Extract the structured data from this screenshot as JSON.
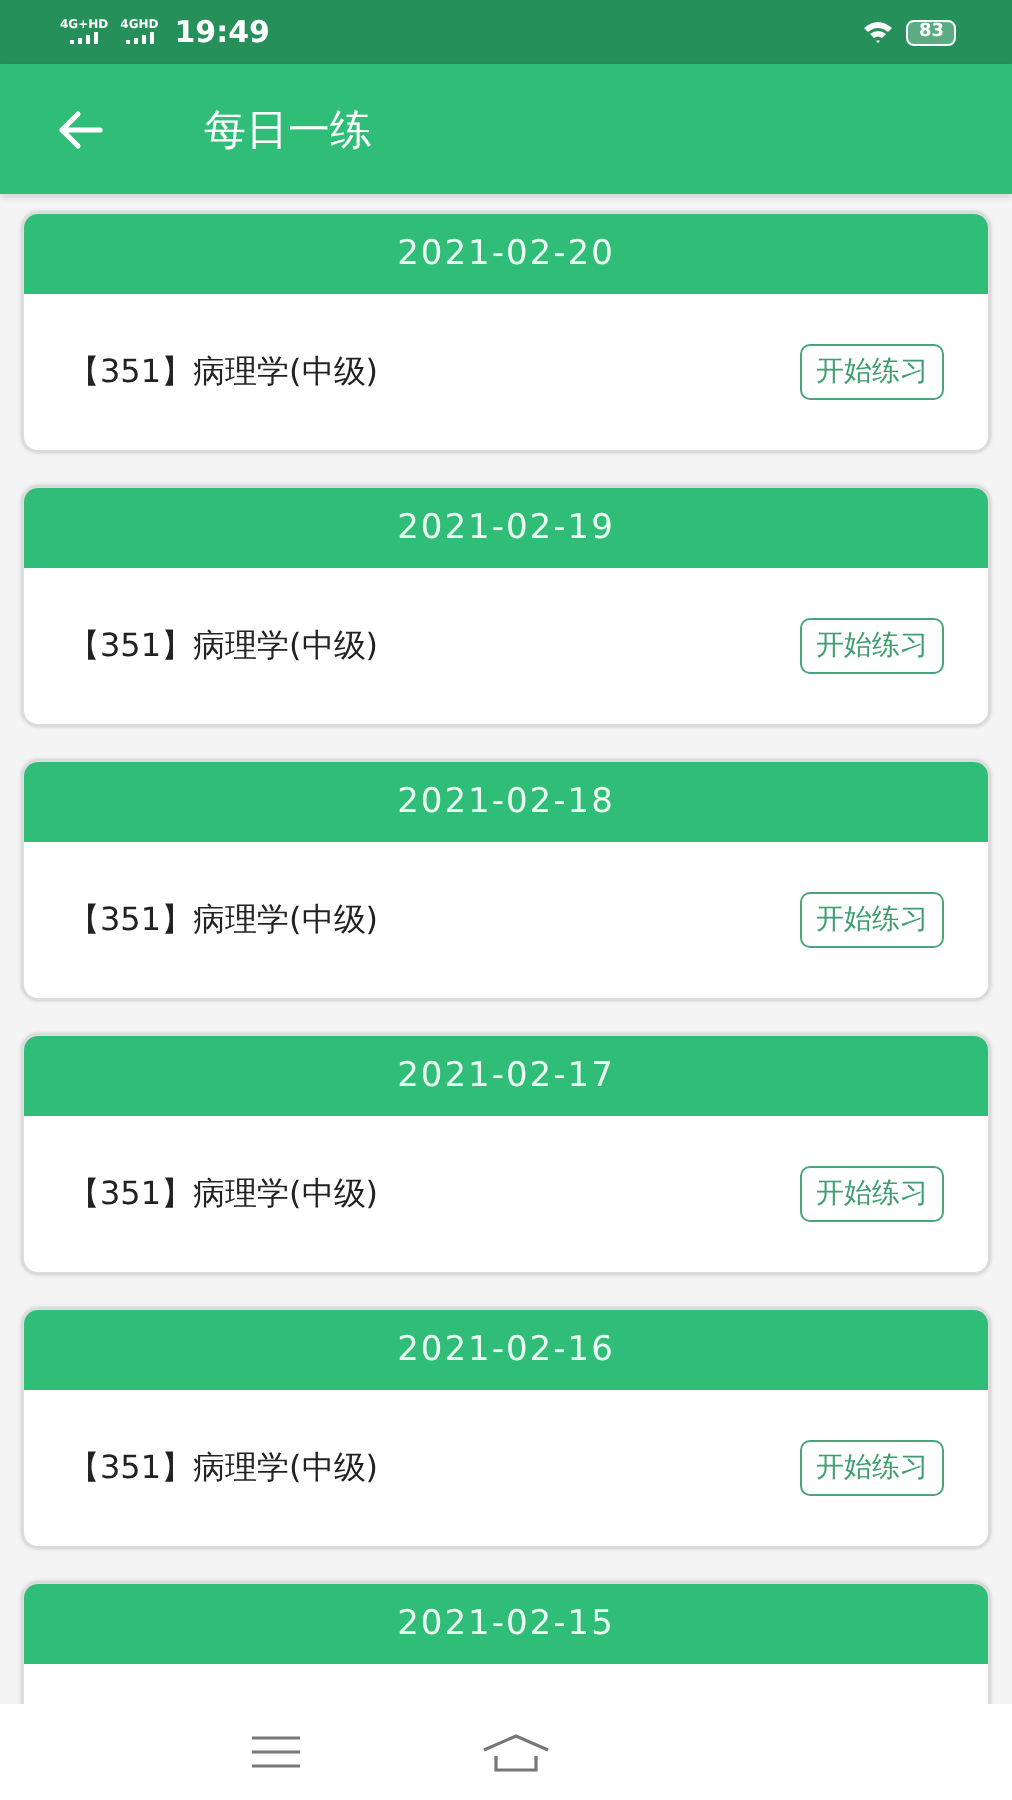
{
  "status_bar": {
    "networks": [
      "4G+HD",
      "4GHD"
    ],
    "time": "19:49",
    "battery": "83"
  },
  "app_bar": {
    "title": "每日一练"
  },
  "cards": [
    {
      "date": "2021-02-20",
      "title": "【351】病理学(中级)",
      "button": "开始练习"
    },
    {
      "date": "2021-02-19",
      "title": "【351】病理学(中级)",
      "button": "开始练习"
    },
    {
      "date": "2021-02-18",
      "title": "【351】病理学(中级)",
      "button": "开始练习"
    },
    {
      "date": "2021-02-17",
      "title": "【351】病理学(中级)",
      "button": "开始练习"
    },
    {
      "date": "2021-02-16",
      "title": "【351】病理学(中级)",
      "button": "开始练习"
    },
    {
      "date": "2021-02-15"
    }
  ]
}
